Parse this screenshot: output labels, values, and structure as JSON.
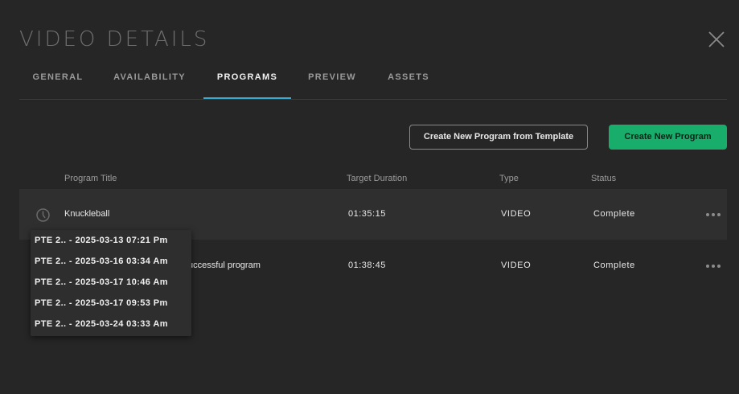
{
  "header": {
    "title": "VIDEO DETAILS",
    "close_icon": "close-icon"
  },
  "tabs": [
    {
      "label": "GENERAL",
      "active": false
    },
    {
      "label": "AVAILABILITY",
      "active": false
    },
    {
      "label": "PROGRAMS",
      "active": true
    },
    {
      "label": "PREVIEW",
      "active": false
    },
    {
      "label": "ASSETS",
      "active": false
    }
  ],
  "actions": {
    "create_from_template": "Create New Program from Template",
    "create_new": "Create New Program"
  },
  "table": {
    "columns": {
      "title": "Program Title",
      "duration": "Target Duration",
      "type": "Type",
      "status": "Status"
    },
    "rows": [
      {
        "title": "Knuckleball",
        "duration": "01:35:15",
        "type": "VIDEO",
        "status": "Complete"
      },
      {
        "title": "uccessful program",
        "duration": "01:38:45",
        "type": "VIDEO",
        "status": "Complete"
      }
    ]
  },
  "history_dropdown": {
    "items": [
      "PTE 2.. - 2025-03-13 07:21 Pm",
      "PTE 2.. - 2025-03-16 03:34 Am",
      "PTE 2.. - 2025-03-17 10:46 Am",
      "PTE 2.. - 2025-03-17 09:53 Pm",
      "PTE 2.. - 2025-03-24 03:33 Am"
    ]
  },
  "colors": {
    "background": "#262626",
    "accent_tab": "#3aa9cf",
    "primary_button": "#18ad6a"
  }
}
